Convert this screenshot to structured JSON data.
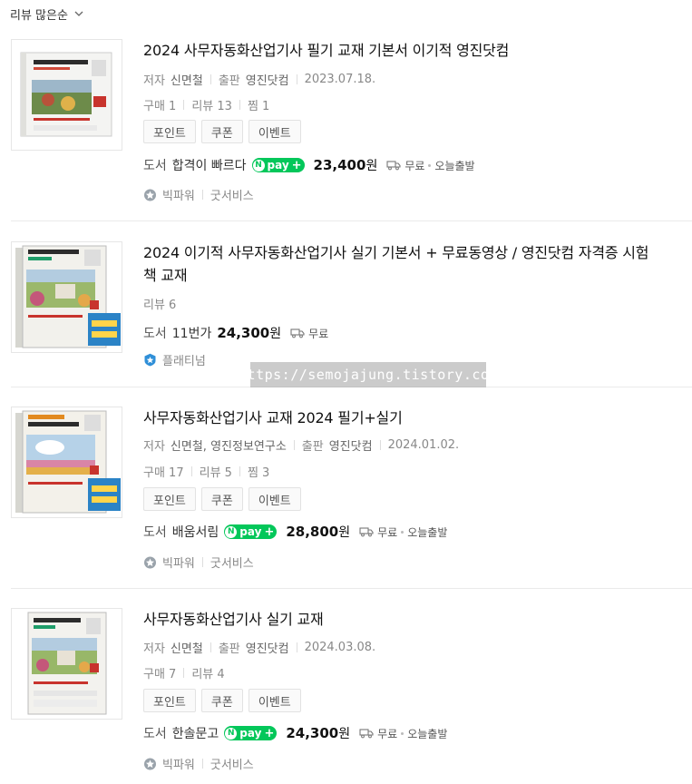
{
  "sort": {
    "label": "리뷰 많은순",
    "icon": "chevron-down-icon"
  },
  "watermark": "https://semojajung.tistory.com",
  "colors": {
    "npay": "#03c75a",
    "badge_gray": "#9aa3ab",
    "badge_blue": "#2f8fd8"
  },
  "labels": {
    "author": "저자",
    "publisher": "출판",
    "category": "도서",
    "won": "원"
  },
  "items": [
    {
      "title": "2024 사무자동화산업기사 필기 교재 기본서 이기적 영진닷컴",
      "author": "신면철",
      "publisher": "영진닷컴",
      "date": "2023.07.18.",
      "stats": [
        "구매 1",
        "리뷰 13",
        "찜 1"
      ],
      "chips": [
        "포인트",
        "쿠폰",
        "이벤트"
      ],
      "seller": "합격이 빠르다",
      "npay": "pay",
      "price": "23,400",
      "shipping": "무료",
      "shipping_extra": "오늘출발",
      "grade": "빅파워",
      "grade_extra": "굿서비스"
    },
    {
      "title_line1": "2024 이기적 사무자동화산업기사 실기 기본서 + 무료동영상 / 영진닷컴 자격증 시험",
      "title_line2": "책 교재",
      "stats": [
        "리뷰 6"
      ],
      "seller": "11번가",
      "price": "24,300",
      "shipping": "무료",
      "grade": "플래티넘"
    },
    {
      "title": "사무자동화산업기사 교재 2024 필기+실기",
      "author": "신면철, 영진정보연구소",
      "publisher": "영진닷컴",
      "date": "2024.01.02.",
      "stats": [
        "구매 17",
        "리뷰 5",
        "찜 3"
      ],
      "chips": [
        "포인트",
        "쿠폰",
        "이벤트"
      ],
      "seller": "배움서림",
      "npay": "pay",
      "price": "28,800",
      "shipping": "무료",
      "shipping_extra": "오늘출발",
      "grade": "빅파워",
      "grade_extra": "굿서비스"
    },
    {
      "title": "사무자동화산업기사 실기 교재",
      "author": "신면철",
      "publisher": "영진닷컴",
      "date": "2024.03.08.",
      "stats": [
        "구매 7",
        "리뷰 4"
      ],
      "chips": [
        "포인트",
        "쿠폰",
        "이벤트"
      ],
      "seller": "한솔문고",
      "npay": "pay",
      "price": "24,300",
      "shipping": "무료",
      "shipping_extra": "오늘출발",
      "grade": "빅파워",
      "grade_extra": "굿서비스"
    }
  ]
}
